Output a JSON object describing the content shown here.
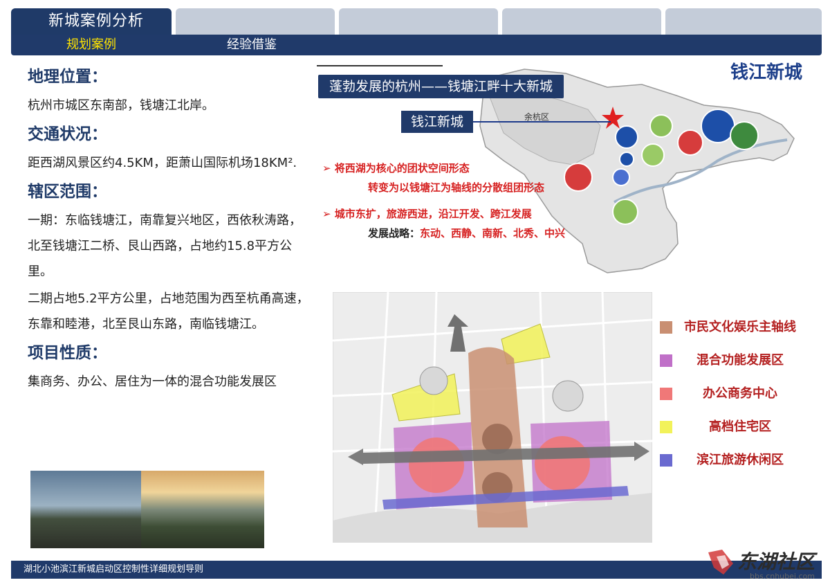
{
  "header": {
    "tabs": [
      "新城案例分析",
      "",
      "",
      "",
      ""
    ],
    "subtabs": [
      "规划案例",
      "经验借鉴"
    ]
  },
  "content": {
    "sections": [
      {
        "title": "地理位置：",
        "paragraphs": [
          "杭州市城区东南部，钱塘江北岸。"
        ]
      },
      {
        "title": "交通状况：",
        "paragraphs": [
          "距西湖风景区约4.5KM，距萧山国际机场18KM²."
        ]
      },
      {
        "title": "辖区范围：",
        "paragraphs": [
          "一期：东临钱塘江，南靠复兴地区，西依秋涛路，北至钱塘江二桥、艮山西路，占地约15.8平方公里。",
          "二期占地5.2平方公里，占地范围为西至杭甬高速，东靠和睦港，北至艮山东路，南临钱塘江。"
        ]
      },
      {
        "title": "项目性质：",
        "paragraphs": [
          "集商务、办公、居住为一体的混合功能发展区"
        ]
      }
    ]
  },
  "map": {
    "title": "钱江新城",
    "banner": "蓬勃发展的杭州——钱塘江畔十大新城",
    "label": "钱江新城",
    "district": "余杭区",
    "bullets": [
      {
        "prefix": "➢ ",
        "text": "将西湖为核心的团状空间形态"
      },
      {
        "text": "转变为以钱塘江为轴线的分散组团形态"
      },
      {
        "prefix": "➢ ",
        "text": "城市东扩，旅游西进，沿江开发、跨江发展"
      },
      {
        "label": "发展战略：",
        "text": "东动、西静、南新、北秀、中兴"
      }
    ],
    "colors": {
      "banner": "#203a6a",
      "emphasis": "#d62020"
    }
  },
  "legend": [
    {
      "label": "市民文化娱乐主轴线",
      "color": "#c98f72"
    },
    {
      "label": "混合功能发展区",
      "color": "#c070c8"
    },
    {
      "label": "办公商务中心",
      "color": "#f07878"
    },
    {
      "label": "高档住宅区",
      "color": "#f2f25a"
    },
    {
      "label": "滨江旅游休闲区",
      "color": "#6a6ad0"
    }
  ],
  "footer": {
    "text": "湖北小池滨江新城启动区控制性详细规划导则"
  },
  "watermark": {
    "text": "东湖社区",
    "url": "bbs.cnhubei.com"
  }
}
